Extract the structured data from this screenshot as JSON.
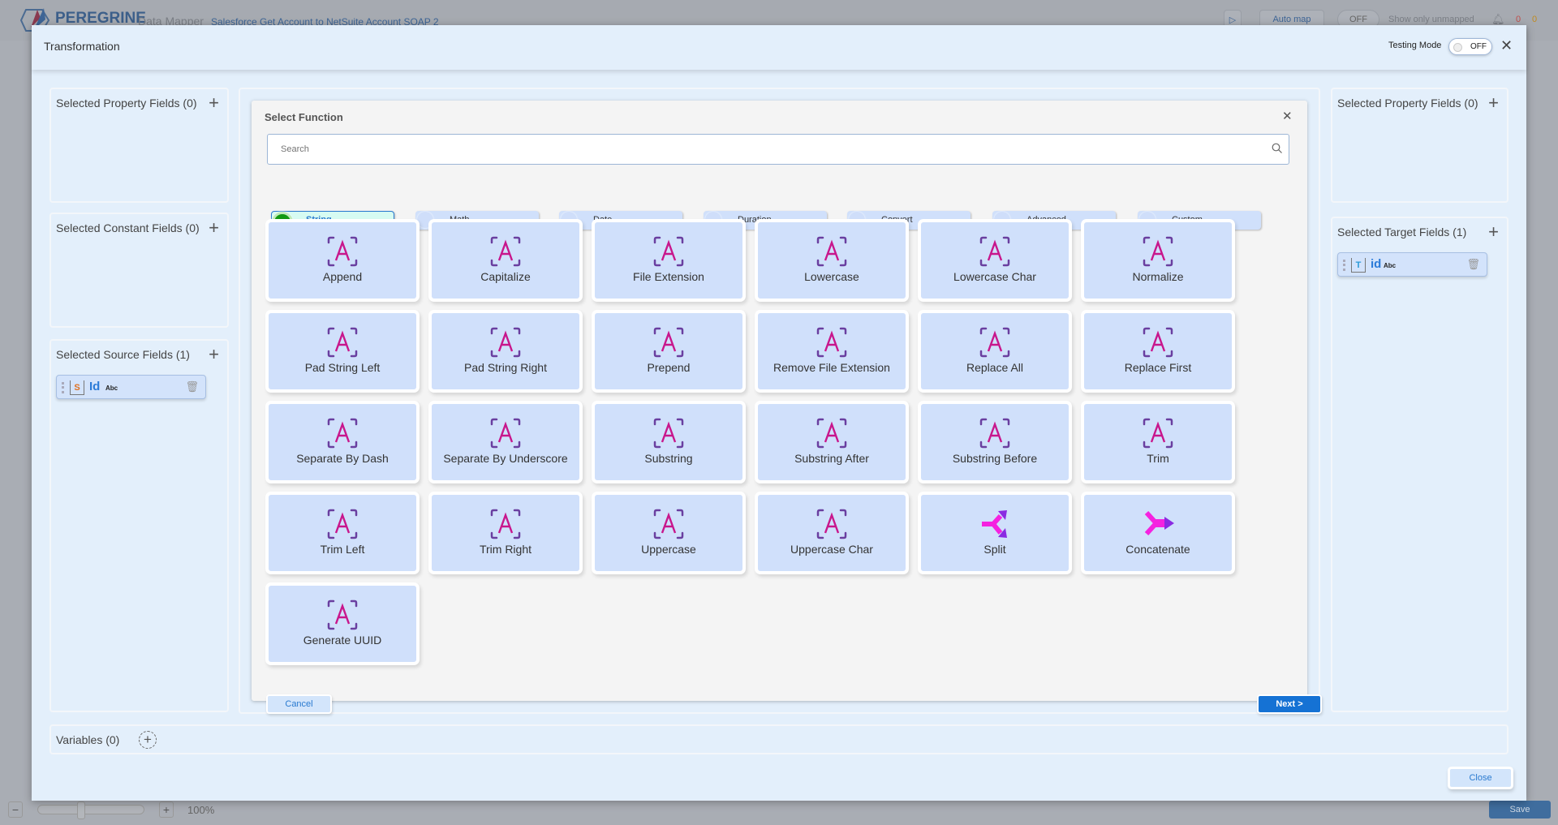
{
  "background": {
    "brand": "PEREGRINE",
    "app_name": "Data Mapper",
    "project": "Salesforce Get Account to NetSuite Account SOAP 2",
    "auto_map": "Auto map",
    "unmapped_toggle": "OFF",
    "unmapped_label": "Show only unmapped",
    "error_count": "0",
    "warning_count": "0",
    "zoom": "100%",
    "save": "Save"
  },
  "modal": {
    "title": "Transformation",
    "testing_mode_label": "Testing Mode",
    "testing_mode_value": "OFF",
    "close_label": "Close"
  },
  "left": {
    "property_fields": "Selected Property Fields (0)",
    "constant_fields": "Selected Constant Fields (0)",
    "source_fields": "Selected Source Fields (1)",
    "source_chip": {
      "name": "Id",
      "type": "Abc"
    }
  },
  "right": {
    "property_fields": "Selected Property Fields (0)",
    "target_fields": "Selected Target Fields (1)",
    "target_chip": {
      "name": "id",
      "type": "Abc"
    }
  },
  "variables": {
    "label": "Variables (0)"
  },
  "select_function": {
    "title": "Select Function",
    "search_placeholder": "Search",
    "categories": [
      "String",
      "Math",
      "Date",
      "Duration",
      "Convert",
      "Advanced",
      "Custom"
    ],
    "active_category": "String",
    "functions": [
      {
        "label": "Append",
        "icon": "text-a-icon"
      },
      {
        "label": "Capitalize",
        "icon": "text-a-icon"
      },
      {
        "label": "File Extension",
        "icon": "text-a-icon"
      },
      {
        "label": "Lowercase",
        "icon": "text-a-icon"
      },
      {
        "label": "Lowercase Char",
        "icon": "text-a-icon"
      },
      {
        "label": "Normalize",
        "icon": "text-a-icon"
      },
      {
        "label": "Pad String Left",
        "icon": "text-a-icon"
      },
      {
        "label": "Pad String Right",
        "icon": "text-a-icon"
      },
      {
        "label": "Prepend",
        "icon": "text-a-icon"
      },
      {
        "label": "Remove File Extension",
        "icon": "text-a-icon"
      },
      {
        "label": "Replace All",
        "icon": "text-a-icon"
      },
      {
        "label": "Replace First",
        "icon": "text-a-icon"
      },
      {
        "label": "Separate By Dash",
        "icon": "text-a-icon"
      },
      {
        "label": "Separate By Underscore",
        "icon": "text-a-icon"
      },
      {
        "label": "Substring",
        "icon": "text-a-icon"
      },
      {
        "label": "Substring After",
        "icon": "text-a-icon"
      },
      {
        "label": "Substring Before",
        "icon": "text-a-icon"
      },
      {
        "label": "Trim",
        "icon": "text-a-icon"
      },
      {
        "label": "Trim Left",
        "icon": "text-a-icon"
      },
      {
        "label": "Trim Right",
        "icon": "text-a-icon"
      },
      {
        "label": "Uppercase",
        "icon": "text-a-icon"
      },
      {
        "label": "Uppercase Char",
        "icon": "text-a-icon"
      },
      {
        "label": "Split",
        "icon": "split-icon"
      },
      {
        "label": "Concatenate",
        "icon": "concatenate-icon"
      },
      {
        "label": "Generate UUID",
        "icon": "text-a-icon"
      }
    ],
    "cancel_label": "Cancel",
    "next_label": "Next >"
  },
  "colors": {
    "accent": "#1572d4",
    "card": "#d0e0fb",
    "icon_letter": "#c8168c",
    "icon_bracket": "#6a3fa0",
    "active_radio": "#119911"
  }
}
